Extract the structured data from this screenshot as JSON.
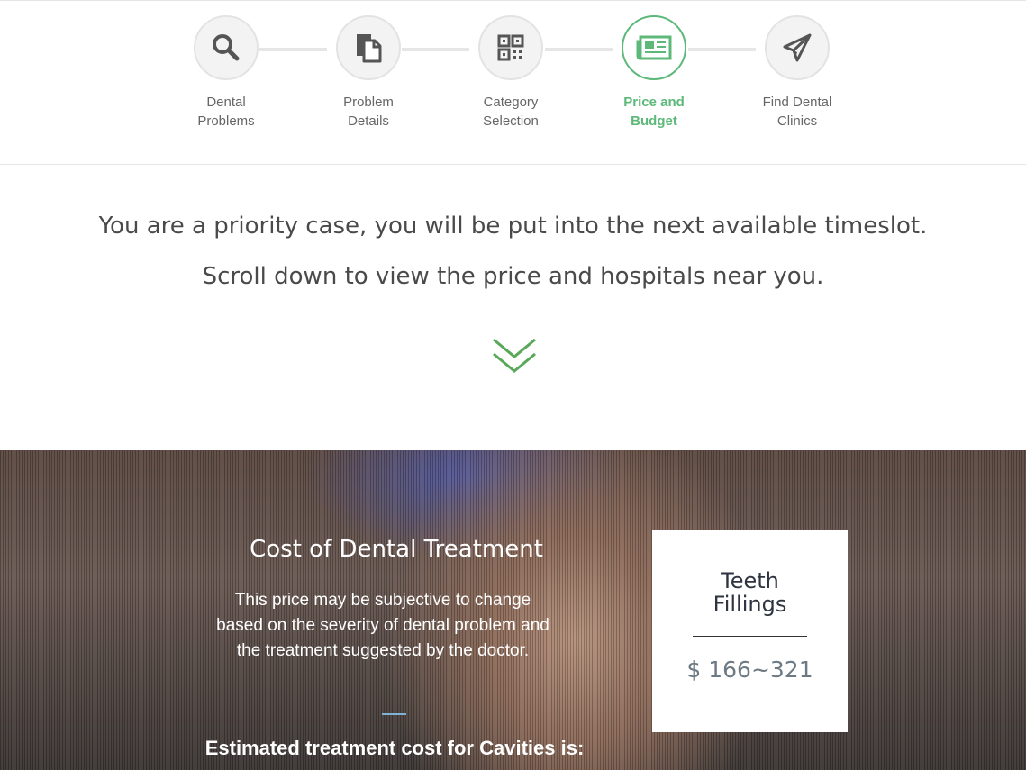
{
  "stepper": {
    "steps": [
      {
        "label_line1": "Dental",
        "label_line2": "Problems",
        "icon": "search-icon",
        "active": false
      },
      {
        "label_line1": "Problem",
        "label_line2": "Details",
        "icon": "documents-icon",
        "active": false
      },
      {
        "label_line1": "Category",
        "label_line2": "Selection",
        "icon": "qr-code-icon",
        "active": false
      },
      {
        "label_line1": "Price and",
        "label_line2": "Budget",
        "icon": "newspaper-icon",
        "active": true
      },
      {
        "label_line1": "Find Dental",
        "label_line2": "Clinics",
        "icon": "paper-plane-icon",
        "active": false
      }
    ]
  },
  "message": {
    "line1": "You are a priority case, you will be put into the next available timeslot.",
    "line2": "Scroll down to view the price and hospitals near you."
  },
  "cost": {
    "title": "Cost of Dental Treatment",
    "description": "This price may be subjective to change based on the severity of dental problem and the treatment suggested by the doctor.",
    "estimate": "Estimated treatment cost for Cavities is:"
  },
  "price_card": {
    "name_line1": "Teeth",
    "name_line2": "Fillings",
    "price": "$ 166~321"
  },
  "colors": {
    "accent": "#5cb97a",
    "chevron": "#5aa95a",
    "icon": "#555555"
  }
}
